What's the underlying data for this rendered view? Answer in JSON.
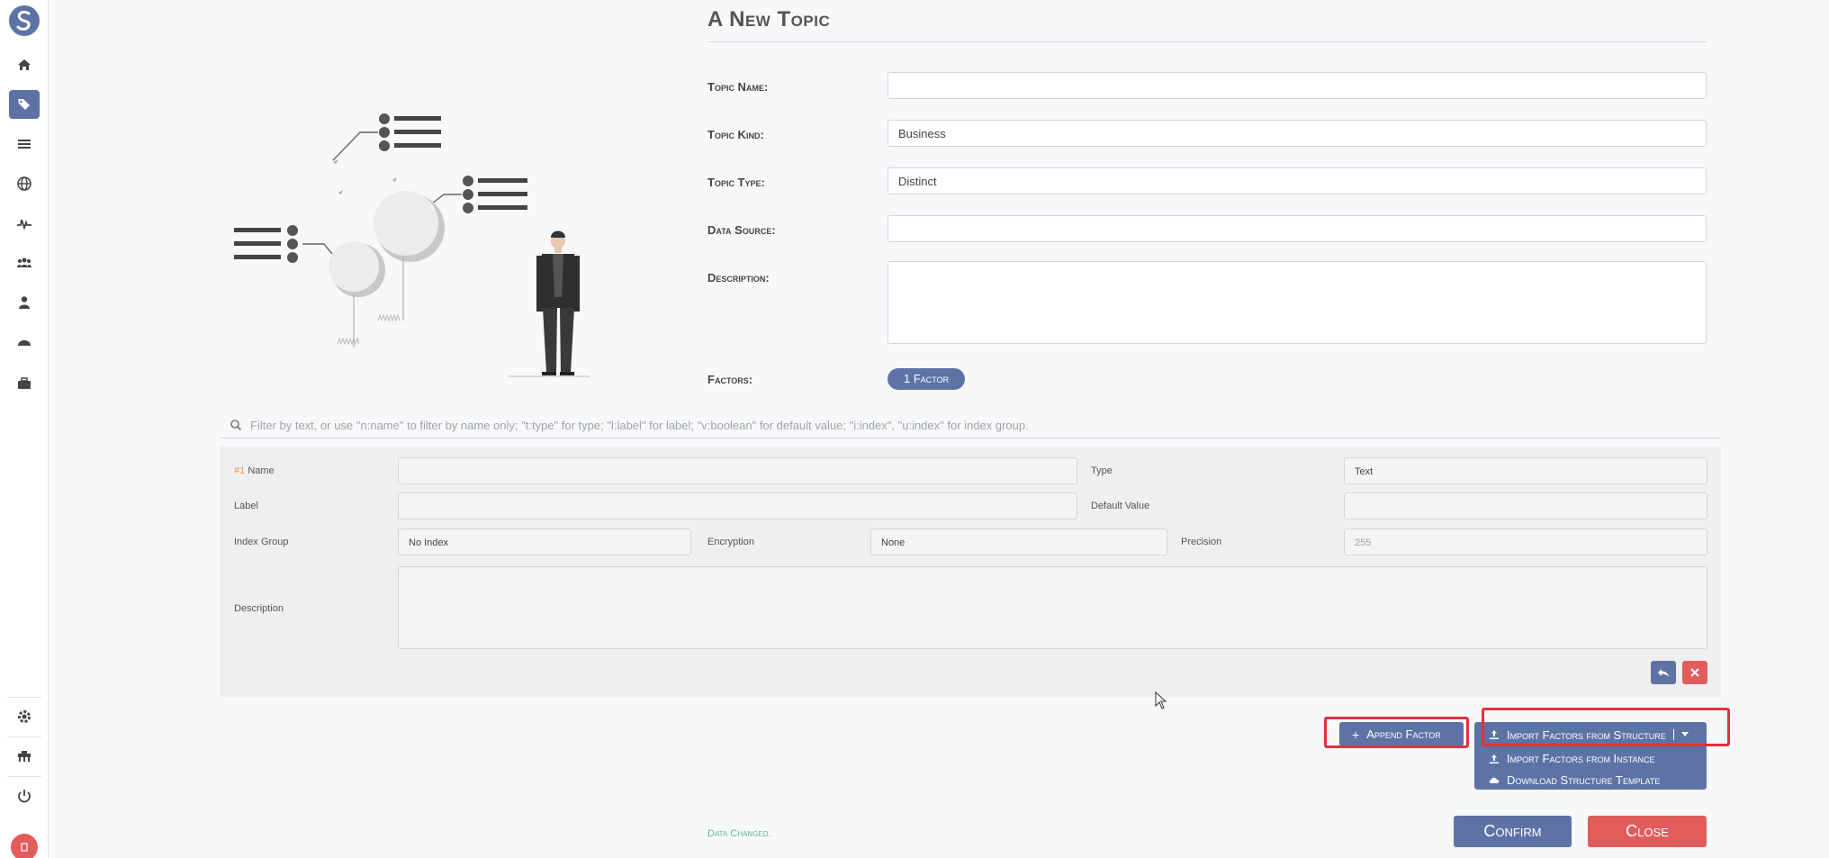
{
  "page": {
    "title": "A New Topic"
  },
  "form": {
    "topic_name_label": "Topic Name:",
    "topic_name_value": "",
    "topic_kind_label": "Topic Kind:",
    "topic_kind_value": "Business",
    "topic_type_label": "Topic Type:",
    "topic_type_value": "Distinct",
    "data_source_label": "Data Source:",
    "data_source_value": "",
    "description_label": "Description:",
    "factors_label": "Factors:",
    "factors_badge": "1 Factor"
  },
  "filter": {
    "placeholder": "Filter by text, or use \"n:name\" to filter by name only; \"t:type\" for type; \"l:label\" for label; \"v:boolean\" for default value; \"i:index\", \"u:index\" for index group."
  },
  "factor": {
    "number": "#1",
    "name_label": "Name",
    "name_value": "",
    "type_label": "Type",
    "type_value": "Text",
    "label_label": "Label",
    "label_value": "",
    "default_value_label": "Default Value",
    "default_value_value": "",
    "index_group_label": "Index Group",
    "index_group_value": "No Index",
    "encryption_label": "Encryption",
    "encryption_value": "None",
    "precision_label": "Precision",
    "precision_value": "255",
    "description_label": "Description"
  },
  "actions": {
    "append_factor": "Append Factor",
    "import_structure": "Import Factors from Structure",
    "import_instance": "Import Factors from Instance",
    "download_template": "Download Structure Template"
  },
  "footer": {
    "status": "Data Changed.",
    "confirm": "Confirm",
    "close": "Close"
  },
  "colors": {
    "primary": "#5d73a6",
    "danger": "#e25c5c",
    "highlight": "#e0333a",
    "status_text": "#5ab98d"
  },
  "icons": {
    "sidebar": [
      "logo-icon",
      "home-icon",
      "tags-icon",
      "list-icon",
      "globe-icon",
      "pulse-icon",
      "users-icon",
      "user-icon",
      "dashboard-icon",
      "toolbox-icon",
      "gear-icon",
      "network-icon",
      "power-icon"
    ]
  }
}
